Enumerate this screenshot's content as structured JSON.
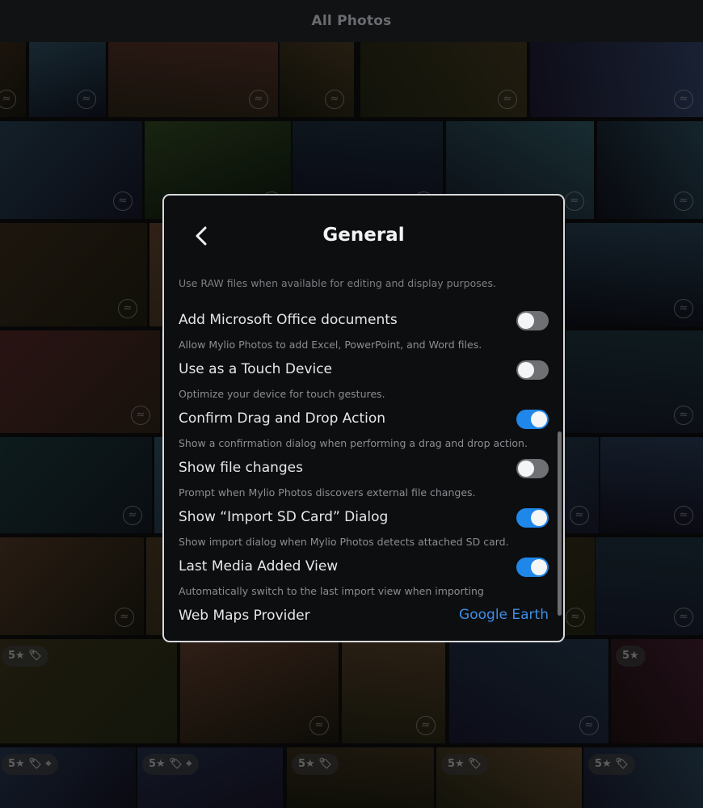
{
  "app": {
    "title": "All Photos"
  },
  "dialog": {
    "title": "General",
    "partial_description": "Use RAW files when available for editing and display purposes.",
    "settings": [
      {
        "label": "Add Microsoft Office documents",
        "description": "Allow Mylio Photos to add Excel, PowerPoint, and Word files.",
        "enabled": false
      },
      {
        "label": "Use as a Touch Device",
        "description": "Optimize your device for touch gestures.",
        "enabled": false
      },
      {
        "label": "Confirm Drag and Drop Action",
        "description": "Show a confirmation dialog when performing a drag and drop action.",
        "enabled": true
      },
      {
        "label": "Show file changes",
        "description": "Prompt when Mylio Photos discovers external file changes.",
        "enabled": false
      },
      {
        "label": "Show “Import SD Card” Dialog",
        "description": "Show import dialog when Mylio Photos detects attached SD card.",
        "enabled": true
      },
      {
        "label": "Last Media Added View",
        "description": "Automatically switch to the last import view when importing",
        "enabled": true
      }
    ],
    "maps_provider": {
      "label": "Web Maps Provider",
      "value": "Google Earth"
    }
  },
  "photo_grid": {
    "badges": [
      "5★ 🏷",
      "5★",
      "5★ 🏷 ⌖",
      "5★ 🏷 ⌖",
      "5★ 🏷",
      "5★ 🏷",
      "5★ 🏷"
    ]
  },
  "colors": {
    "accent": "#1f87ea",
    "link": "#3d8ee6",
    "toggle_off": "#6e7074",
    "dialog_bg": "#0d0e10",
    "dialog_border": "#d8d9db"
  },
  "icons": {
    "back": "chevron-left-icon",
    "tile_glyph": "wave-icon",
    "badge": "rating-icon"
  }
}
